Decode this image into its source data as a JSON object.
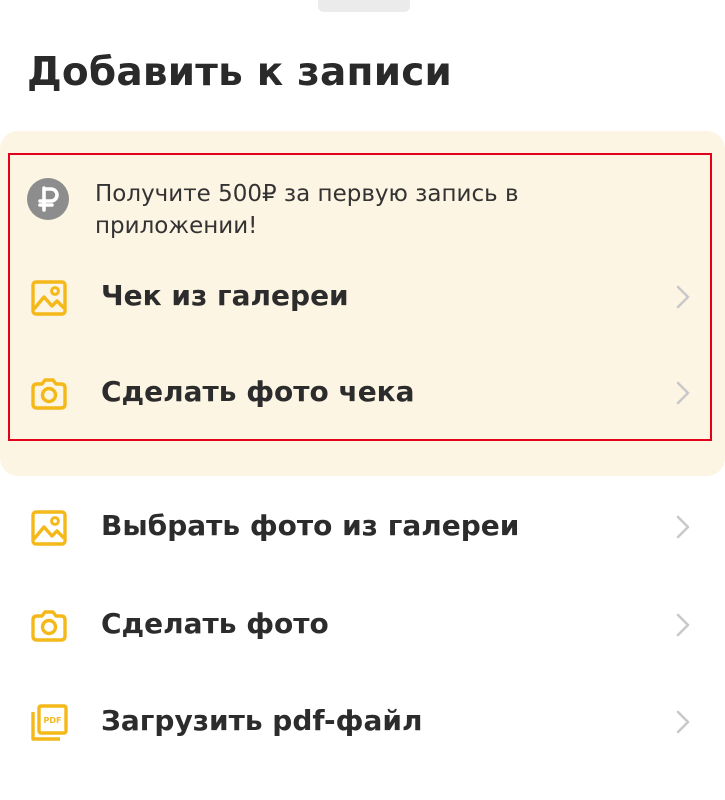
{
  "sheet": {
    "title": "Добавить к записи"
  },
  "promo": {
    "text": "Получите 500₽ за первую запись в приложении!",
    "icon": "ruble-icon",
    "background_color": "#fdf5e3",
    "highlight_color": "#e3001b"
  },
  "promo_items": [
    {
      "label": "Чек из галереи",
      "icon": "image-icon"
    },
    {
      "label": "Сделать фото чека",
      "icon": "camera-icon"
    }
  ],
  "items": [
    {
      "label": "Выбрать фото из галереи",
      "icon": "image-icon"
    },
    {
      "label": "Сделать фото",
      "icon": "camera-icon"
    },
    {
      "label": "Загрузить pdf-файл",
      "icon": "pdf-file-icon"
    }
  ],
  "accent_color": "#f4b819",
  "chevron_color": "#c9c9c9"
}
